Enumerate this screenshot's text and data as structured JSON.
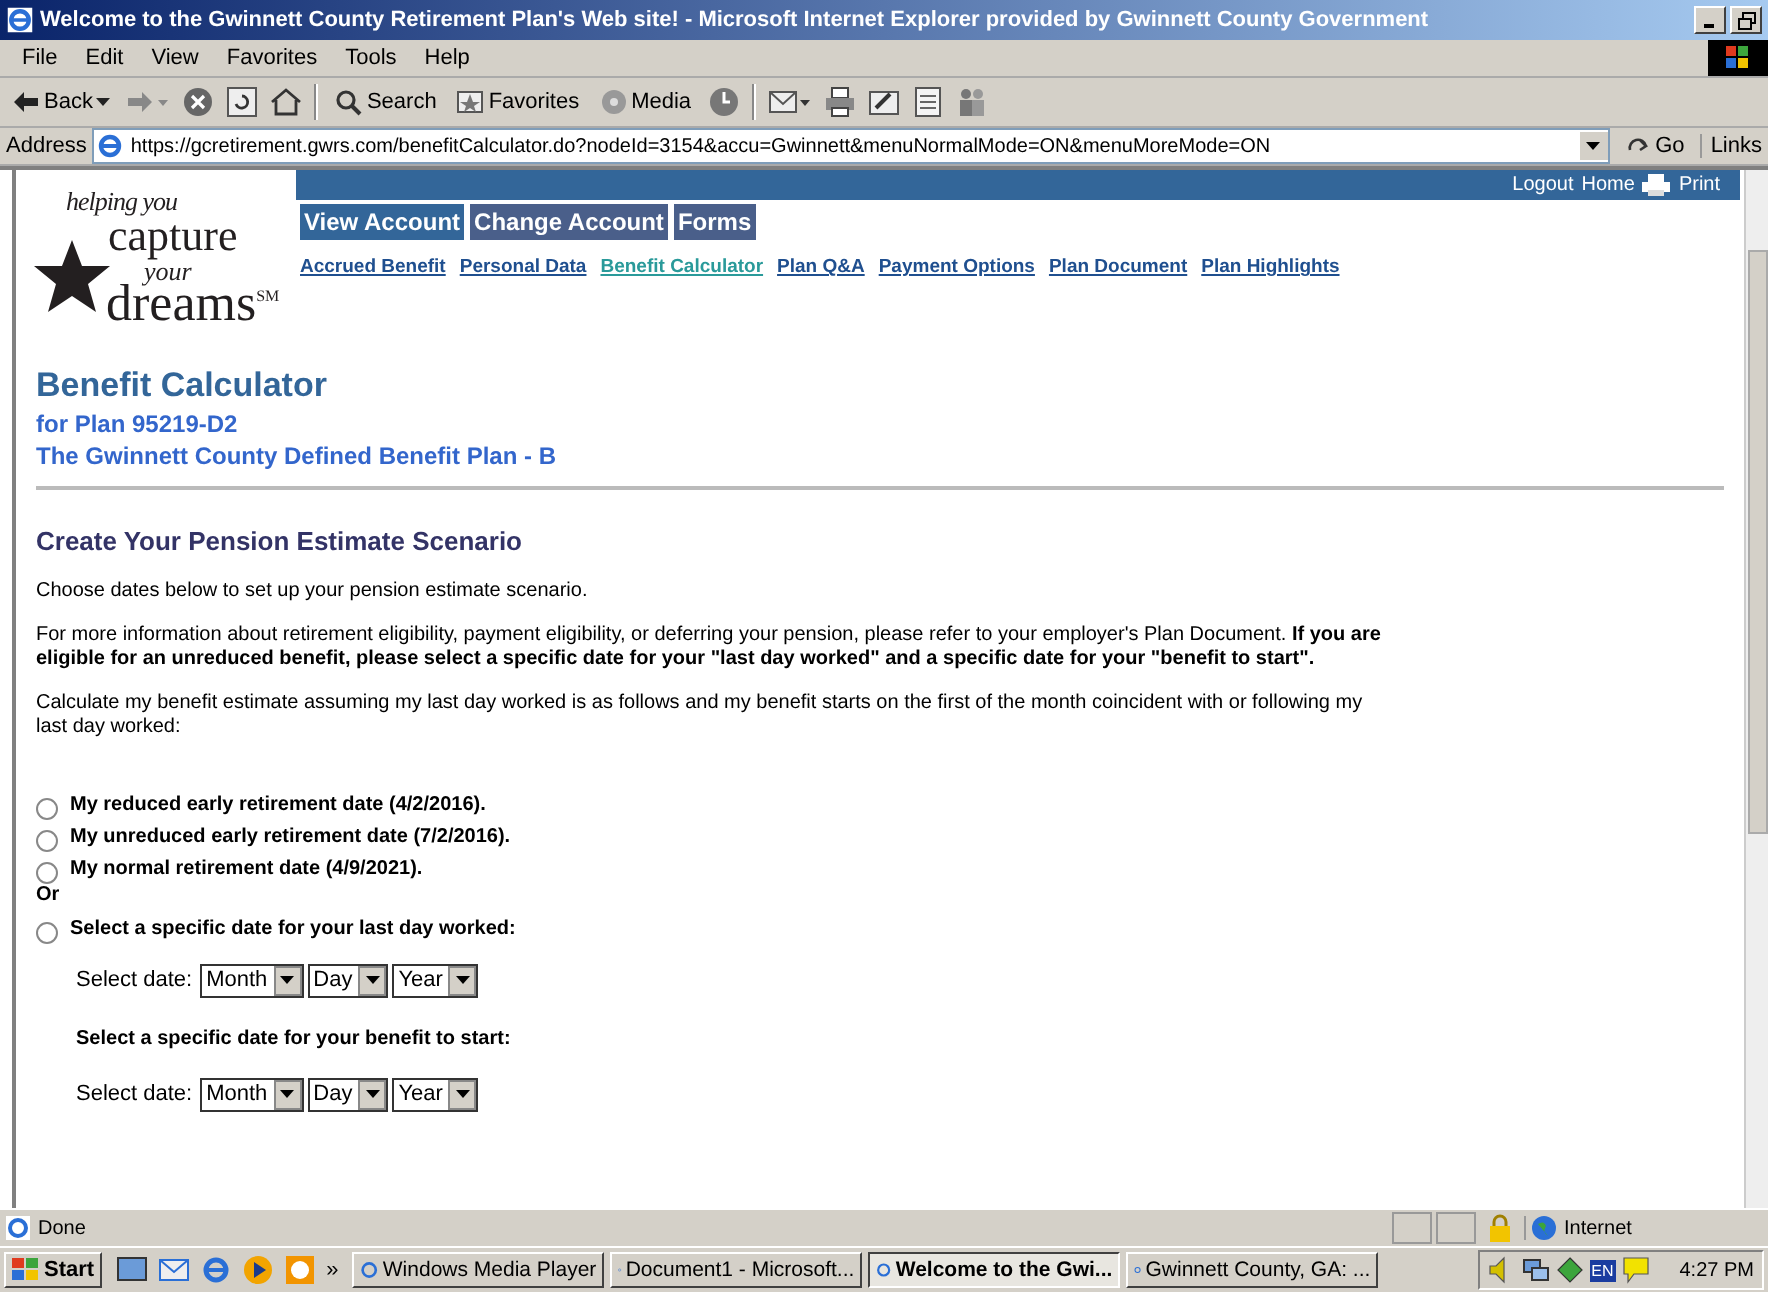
{
  "window": {
    "title": "Welcome to the Gwinnett County Retirement Plan's Web site! - Microsoft Internet Explorer provided by Gwinnett County Government"
  },
  "menu": [
    "File",
    "Edit",
    "View",
    "Favorites",
    "Tools",
    "Help"
  ],
  "toolbar": [
    "Back",
    "Search",
    "Favorites",
    "Media"
  ],
  "address": {
    "label": "Address",
    "value": "https://gcretirement.gwrs.com/benefitCalculator.do?nodeId=3154&accu=Gwinnett&menuNormalMode=ON&menuMoreMode=ON",
    "go": "Go",
    "links": "Links"
  },
  "logo": {
    "line_1": "helping you",
    "line_2": "capture",
    "line_3": "your",
    "line_4": "dreams$^{SM}$"
  },
  "top_links": [
    "Logout",
    "Home",
    "Print"
  ],
  "nav_tabs": [
    {
      "label": "View Account",
      "selected": true
    },
    {
      "label": "Change Account",
      "selected": false
    },
    {
      "label": "Forms",
      "selected": false
    }
  ],
  "sub_nav": [
    {
      "label": "Accrued Benefit",
      "selected": false
    },
    {
      "label": "Personal Data",
      "selected": false
    },
    {
      "label": "Benefit Calculator",
      "selected": true
    },
    {
      "label": "Plan Q&A",
      "selected": false
    },
    {
      "label": "Payment Options",
      "selected": false
    },
    {
      "label": "Plan Document",
      "selected": false
    },
    {
      "label": "Plan Highlights",
      "selected": false
    }
  ],
  "page": {
    "title": "Benefit Calculator",
    "plan": "for Plan 95219-D2",
    "plan_name": "The Gwinnett County Defined Benefit Plan - B",
    "section": "Create Your Pension Estimate Scenario",
    "paragraphs": [
      "Choose dates below to set up your pension estimate scenario.",
      "For more information about retirement eligibility, payment eligibility, or deferring your pension, please refer to your employer's Plan Document. **If you are eligible for an unreduced benefit, please select a specific date for your \"last day worked\" and a specific date for your \"benefit to start\".**",
      "Calculate my benefit estimate assuming my last day worked is as follows and my benefit starts on the first of the month coincident with or following my last day worked:"
    ],
    "options": [
      {
        "label": "My reduced early retirement date (4/2/2016).",
        "checked": false
      },
      {
        "label": "My unreduced early retirement date (7/2/2016).",
        "checked": false
      },
      {
        "label": "My normal retirement date (4/9/2021).",
        "checked": false
      }
    ],
    "or": "Or",
    "specific": {
      "label": "Select a specific date for your last day worked:",
      "checked": false
    },
    "last_day": {
      "label": "Select date:",
      "selects": [
        "Month",
        "Day",
        "Year"
      ]
    },
    "benefit_start_heading": "Select a specific date for your benefit to start:",
    "benefit_start": {
      "label": "Select date:",
      "selects": [
        "Month",
        "Day",
        "Year"
      ]
    }
  },
  "status_bar": {
    "status": "Done",
    "zone": "Internet"
  },
  "taskbar": {
    "start": "Start",
    "more": "»",
    "tasks": [
      {
        "label": "Windows Media Player",
        "selected": false
      },
      {
        "label": "Document1 - Microsoft...",
        "selected": false
      },
      {
        "label": "Welcome to the Gwi...",
        "selected": true
      },
      {
        "label": "Gwinnett County, GA: ...",
        "selected": false
      }
    ],
    "lang": "EN",
    "time": "4:27 PM"
  }
}
